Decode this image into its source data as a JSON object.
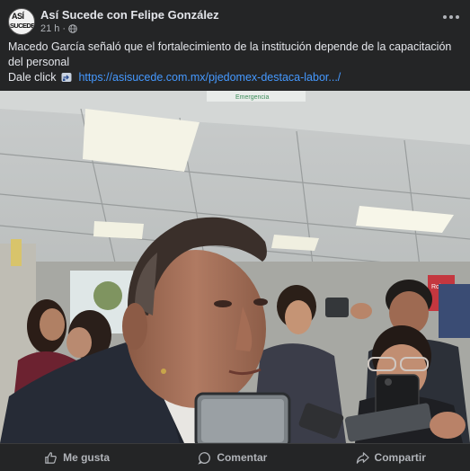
{
  "post": {
    "page_name": "Así Sucede con Felipe González",
    "avatar_text_line1": "ASÍ",
    "avatar_text_line2": "SUCEDE",
    "time": "21 h",
    "separator": "·",
    "privacy_icon": "globe-icon",
    "more_icon": "more-options-icon",
    "caption": "Macedo García señaló que el fortalecimiento de la institución depende de la capacitación del personal",
    "cta_text": "Dale click",
    "cta_icon": "pointing-right-icon",
    "link": "https://asisucede.com.mx/pjedomex-destaca-labor.../"
  },
  "photo": {
    "sign_text": "Emergencia",
    "poster_text": "Roka"
  },
  "actions": [
    {
      "label": "Me gusta",
      "icon": "thumbs-up-icon"
    },
    {
      "label": "Comentar",
      "icon": "comment-icon"
    },
    {
      "label": "Compartir",
      "icon": "share-icon"
    }
  ],
  "colors": {
    "background": "#242526",
    "text": "#e4e6eb",
    "secondary_text": "#b0b3b8",
    "link": "#4599ff"
  }
}
